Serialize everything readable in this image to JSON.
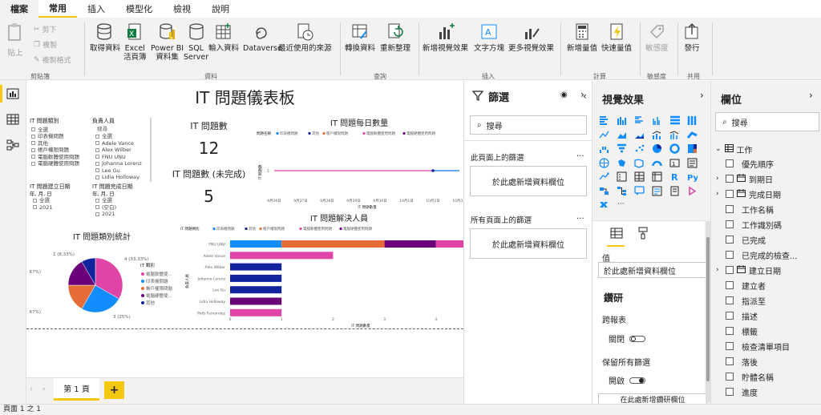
{
  "menu": {
    "tabs": [
      "檔案",
      "常用",
      "插入",
      "模型化",
      "檢視",
      "說明"
    ]
  },
  "ribbon": {
    "paste": "貼上",
    "cut": "剪下",
    "copy": "複製",
    "format_painter": "複製格式",
    "get_data": "取得資料",
    "excel": [
      "Excel",
      "活頁簿"
    ],
    "powerbi": [
      "Power BI",
      "資料集"
    ],
    "sql": [
      "SQL",
      "Server"
    ],
    "enter_data": "輸入資料",
    "dataverse": "Dataverse",
    "recent_sources": "最近使用的來源",
    "transform": "轉換資料",
    "refresh": "重新整理",
    "new_visual": "新增視覺效果",
    "textbox": "文字方塊",
    "more_visuals": "更多視覺效果",
    "new_measure": "新增量值",
    "quick_measure": "快速量值",
    "sensitivity": "敏感度",
    "publish": "發行",
    "groups": {
      "clipboard": "剪貼簿",
      "data": "資料",
      "query": "查詢",
      "insert": "插入",
      "calc": "計算",
      "sensitivity": "敏感度",
      "share": "共用"
    }
  },
  "canvas": {
    "title": "IT 問題儀表板",
    "slicer_type": {
      "title": "IT 問題類別",
      "items": [
        "全選",
        "印表機問題",
        "其他",
        "帳戶權限問題",
        "電腦軟體使用問題",
        "電腦硬體使用問題"
      ]
    },
    "slicer_owner": {
      "title": "負責人員",
      "search": "搜尋",
      "items": [
        "全選",
        "Adele Vance",
        "Alex Wilber",
        "FNU UNU",
        "Johanna Lorenz",
        "Lee Gu",
        "Lidia Holloway"
      ]
    },
    "slicer_created": {
      "title": "IT 問題建立日期",
      "sub": "年, 月, 日",
      "items": [
        "全選",
        "2021"
      ]
    },
    "slicer_done": {
      "title": "IT 問題完成日期",
      "sub": "年, 月, 日",
      "items": [
        "全選",
        "(空白)",
        "2021"
      ]
    },
    "card1": {
      "label": "IT 問題數",
      "value": "12"
    },
    "card2": {
      "label": "IT 問題數 (未完成)",
      "value": "5"
    },
    "pie_title": "IT 問題類別統計",
    "line_title": "IT 問題每日數量",
    "bar_title": "IT 問題解決人員"
  },
  "chart_data": [
    {
      "type": "pie",
      "title": "IT 問題類別統計",
      "legend_title": "IT 類別",
      "categories": [
        "電腦軟體使用問題",
        "印表機問題",
        "帳戶權限問題",
        "電腦硬體使用問題",
        "其他"
      ],
      "values": [
        4,
        3,
        2,
        2,
        1
      ],
      "labels": [
        "4 (33.33%)",
        "3 (25%)",
        "2 (16.67%)",
        "2 (16.67%)",
        "1 (8.33%)"
      ],
      "legend_display": [
        "電腦軟體使...",
        "印表機問題",
        "帳戶權限問題",
        "電腦硬體使...",
        "其他"
      ],
      "colors": [
        "#e044a7",
        "#118dff",
        "#e66c37",
        "#6b007b",
        "#12239e"
      ]
    },
    {
      "type": "line",
      "title": "IT 問題每日數量",
      "legend_title": "問題名稱",
      "legend": [
        "印表機問題",
        "其他",
        "帳戶權限問題",
        "電腦軟體使用問題",
        "電腦硬體使用問題"
      ],
      "xlabel": "IT 問題數量",
      "ylabel": "IT 問題數",
      "x": [
        "9月26日",
        "9月27日",
        "9月28日",
        "9月29日",
        "9月30日",
        "10月1日",
        "10月2日",
        "10月3日"
      ],
      "series": [
        {
          "name": "電腦軟體使用問題",
          "values": [
            1,
            1,
            1,
            1,
            1,
            1,
            1,
            1
          ]
        },
        {
          "name": "印表機問題",
          "values": [
            null,
            null,
            null,
            null,
            null,
            null,
            1,
            1
          ]
        }
      ]
    },
    {
      "type": "bar",
      "title": "IT 問題解決人員",
      "legend_title": "IT 問題類別",
      "legend": [
        "印表機問題",
        "其他",
        "帳戶權限問題",
        "電腦軟體使用問題",
        "電腦硬體使用問題"
      ],
      "ylabel": "負責人員",
      "xlabel": "IT 問題數量",
      "categories": [
        "FNU UNU",
        "Adele Vance",
        "Alex Wilber",
        "Johanna Lorenz",
        "Lee Gu",
        "Lidia Holloway",
        "Patti Fernandez"
      ],
      "xticks": [
        "0",
        "1",
        "2",
        "3",
        "4",
        "5"
      ],
      "xlim": [
        0,
        5
      ],
      "series": [
        {
          "name": "印表機問題",
          "color": "#118dff",
          "values": [
            1,
            0,
            0,
            0,
            0,
            0,
            0
          ]
        },
        {
          "name": "其他",
          "color": "#12239e",
          "values": [
            0,
            0,
            1,
            1,
            1,
            0,
            0
          ]
        },
        {
          "name": "帳戶權限問題",
          "color": "#e66c37",
          "values": [
            2,
            0,
            0,
            0,
            0,
            0,
            0
          ]
        },
        {
          "name": "電腦硬體使用問題",
          "color": "#6b007b",
          "values": [
            1,
            0,
            0,
            0,
            0,
            1,
            0
          ]
        },
        {
          "name": "電腦軟體使用問題",
          "color": "#e044a7",
          "values": [
            1,
            2,
            0,
            0,
            0,
            0,
            1
          ]
        }
      ]
    }
  ],
  "filters": {
    "title": "篩選",
    "search": "搜尋",
    "this_page": "此頁面上的篩選",
    "all_pages": "所有頁面上的篩選",
    "add_field": "於此處新增資料欄位",
    "more": "..."
  },
  "visuals": {
    "title": "視覺效果",
    "values_label": "值",
    "add_field": "於此處新增資料欄位",
    "drill": "鑽研",
    "cross_report": "跨報表",
    "off": "關閉",
    "keep_filters": "保留所有篩選",
    "on": "開啟",
    "drill_field": "在此處新增鑽研欄位",
    "r_label": "R",
    "py_label": "Py",
    "more": "..."
  },
  "fields": {
    "title": "欄位",
    "search": "搜尋",
    "table": "工作",
    "items": [
      {
        "name": "優先順序",
        "type": "field",
        "expand": false
      },
      {
        "name": "到期日",
        "type": "date",
        "expand": true
      },
      {
        "name": "完成日期",
        "type": "date",
        "expand": true
      },
      {
        "name": "工作名稱",
        "type": "field",
        "expand": false
      },
      {
        "name": "工作識別碼",
        "type": "field",
        "expand": false
      },
      {
        "name": "已完成",
        "type": "field",
        "expand": false
      },
      {
        "name": "已完成的檢查...",
        "type": "field",
        "expand": false
      },
      {
        "name": "建立日期",
        "type": "date",
        "expand": true
      },
      {
        "name": "建立者",
        "type": "field",
        "expand": false
      },
      {
        "name": "指派至",
        "type": "field",
        "expand": false
      },
      {
        "name": "描述",
        "type": "field",
        "expand": false
      },
      {
        "name": "標籤",
        "type": "field",
        "expand": false
      },
      {
        "name": "檢查清單項目",
        "type": "field",
        "expand": false
      },
      {
        "name": "落後",
        "type": "field",
        "expand": false
      },
      {
        "name": "貯體名稱",
        "type": "field",
        "expand": false
      },
      {
        "name": "進度",
        "type": "field",
        "expand": false
      }
    ]
  },
  "pages": {
    "tabs": [
      "第 1 頁"
    ],
    "add": "+"
  },
  "status": {
    "text": "頁面 1 之 1"
  }
}
